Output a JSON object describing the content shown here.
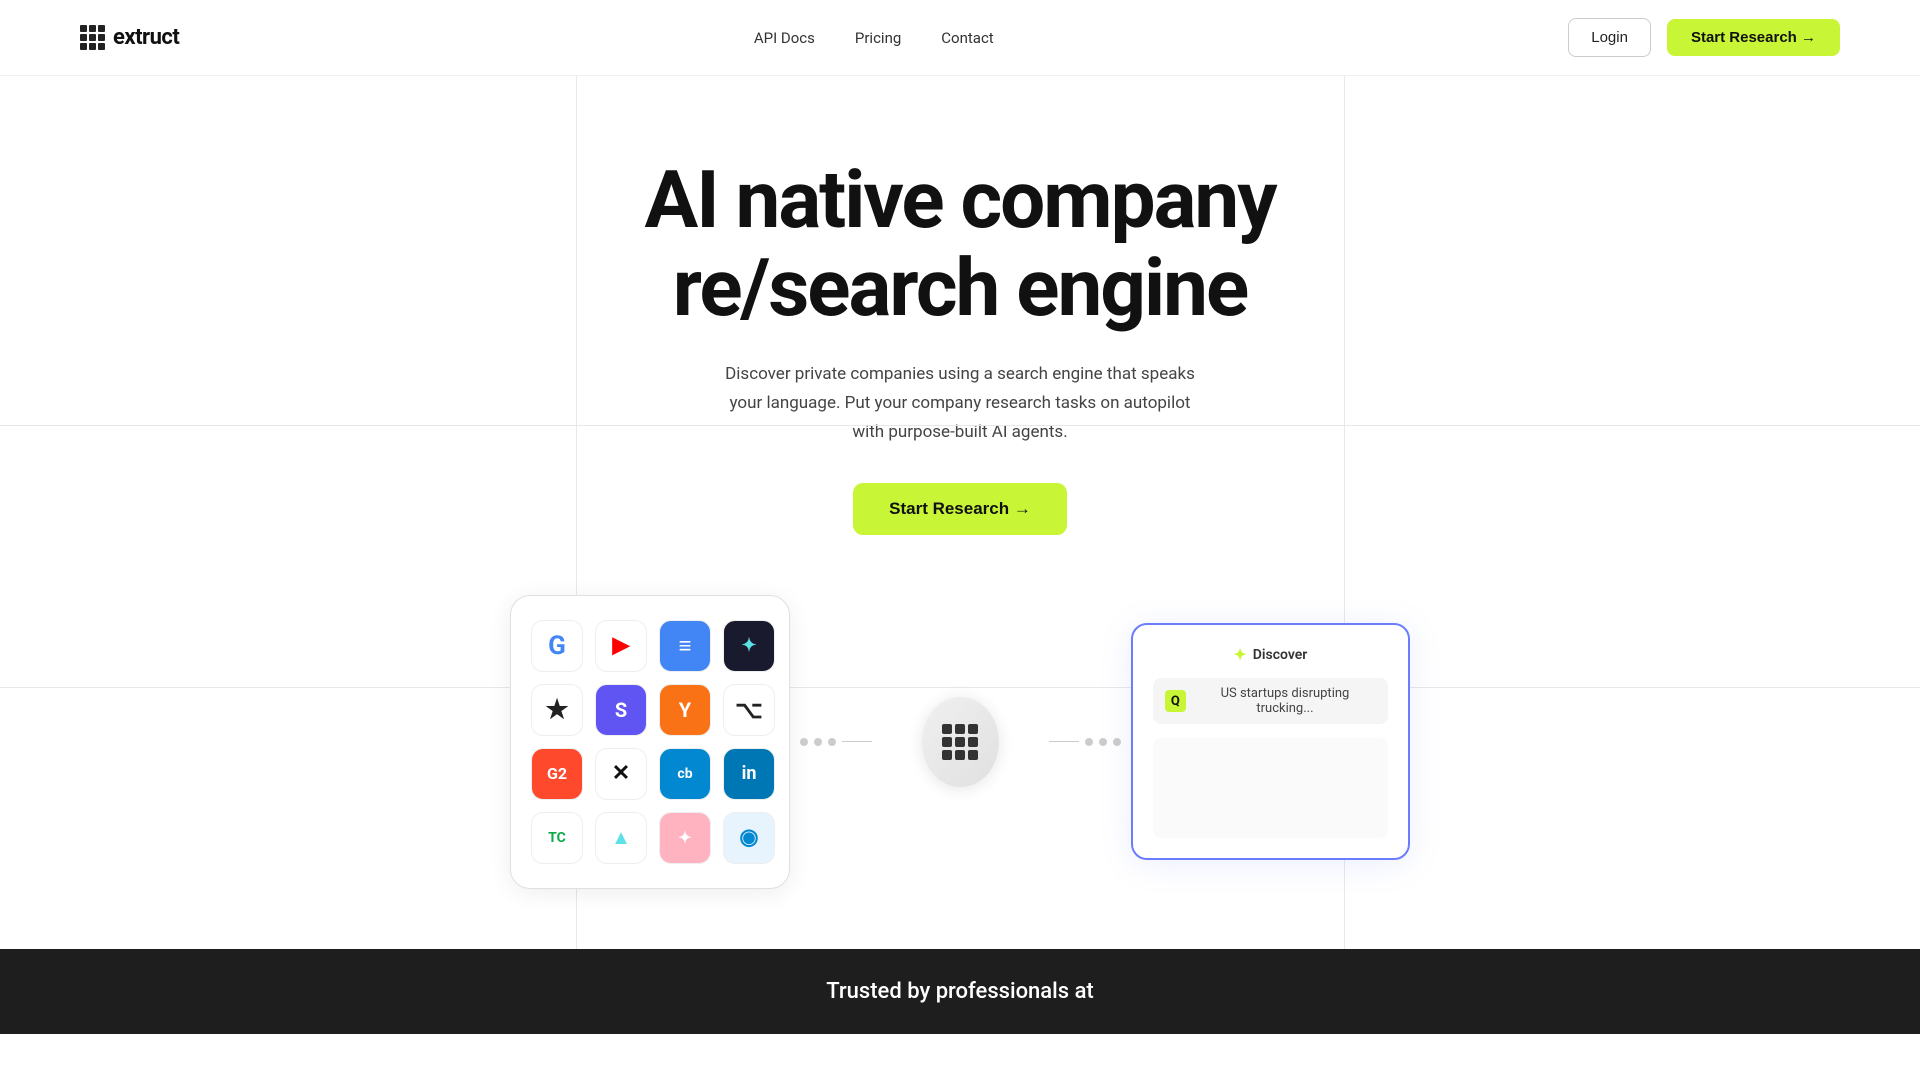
{
  "nav": {
    "logo_name": "extruct",
    "links": [
      {
        "id": "api-docs",
        "label": "API Docs"
      },
      {
        "id": "pricing",
        "label": "Pricing"
      },
      {
        "id": "contact",
        "label": "Contact"
      }
    ],
    "login_label": "Login",
    "start_research_label": "Start Research →"
  },
  "hero": {
    "title_line1": "AI native company",
    "title_line2": "re/search engine",
    "subtitle": "Discover private companies using a search engine that speaks your language. Put your company research tasks on autopilot with purpose-built AI agents.",
    "cta_label": "Start Research →"
  },
  "illustration": {
    "hub_label": "extruct hub",
    "discover_header": "✦ Discover",
    "discover_bolt": "✦",
    "discover_header_text": "Discover",
    "discover_query": "US startups disrupting trucking...",
    "discover_q_label": "Q"
  },
  "logos": [
    {
      "id": "google",
      "bg": "#fff",
      "color": "#4285F4",
      "text": "G"
    },
    {
      "id": "youtube",
      "bg": "#fff",
      "color": "#FF0000",
      "text": "▶"
    },
    {
      "id": "docs",
      "bg": "#4285F4",
      "color": "#fff",
      "text": "≡"
    },
    {
      "id": "feather",
      "bg": "#1a1a2e",
      "color": "#5ce1e6",
      "text": "✦"
    },
    {
      "id": "star",
      "bg": "#fff",
      "color": "#222",
      "text": "★"
    },
    {
      "id": "shortcut",
      "bg": "#6055f2",
      "color": "#fff",
      "text": "S"
    },
    {
      "id": "yc",
      "bg": "#f97316",
      "color": "#fff",
      "text": "Y"
    },
    {
      "id": "github",
      "bg": "#fff",
      "color": "#222",
      "text": "⌥"
    },
    {
      "id": "g2",
      "bg": "#ff492c",
      "color": "#fff",
      "text": "G2"
    },
    {
      "id": "x",
      "bg": "#fff",
      "color": "#111",
      "text": "✕"
    },
    {
      "id": "crunchbase",
      "bg": "#0288d1",
      "color": "#fff",
      "text": "cb"
    },
    {
      "id": "linkedin",
      "bg": "#0077B5",
      "color": "#fff",
      "text": "in"
    },
    {
      "id": "seekout",
      "bg": "#fff",
      "color": "#5ce1e6",
      "text": "▲"
    },
    {
      "id": "techcrunch",
      "bg": "#fff",
      "color": "#0aaa4a",
      "text": "TC"
    },
    {
      "id": "pink",
      "bg": "#ffb3c1",
      "color": "#fff",
      "text": "✦"
    },
    {
      "id": "globe",
      "bg": "#e8f4fd",
      "color": "#0288d1",
      "text": "◉"
    }
  ],
  "bottom_banner": {
    "text": "Trusted by professionals at"
  }
}
